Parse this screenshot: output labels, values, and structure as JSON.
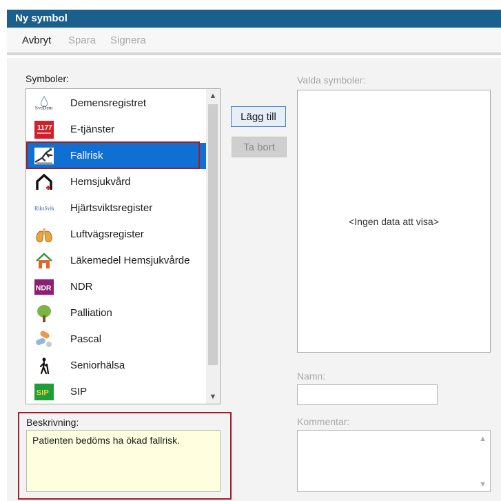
{
  "window": {
    "title": "Ny symbol"
  },
  "toolbar": {
    "cancel": "Avbryt",
    "save": "Spara",
    "sign": "Signera"
  },
  "symbols": {
    "label": "Symboler:",
    "items": [
      {
        "icon": "svedem-logo-icon",
        "label": "Demensregistret"
      },
      {
        "icon": "1177-logo-icon",
        "label": "E-tjänster"
      },
      {
        "icon": "fall-risk-icon",
        "label": "Fallrisk",
        "selected": true
      },
      {
        "icon": "home-care-icon",
        "label": "Hemsjukvård"
      },
      {
        "icon": "rikssvikt-logo-icon",
        "label": "Hjärtsviktsregister"
      },
      {
        "icon": "lungs-icon",
        "label": "Luftvägsregister"
      },
      {
        "icon": "home-medicine-icon",
        "label": "Läkemedel Hemsjukvårde"
      },
      {
        "icon": "ndr-logo-icon",
        "label": "NDR"
      },
      {
        "icon": "tree-icon",
        "label": "Palliation"
      },
      {
        "icon": "pills-icon",
        "label": "Pascal"
      },
      {
        "icon": "walking-person-icon",
        "label": "Seniorhälsa"
      },
      {
        "icon": "sip-logo-icon",
        "label": "SIP"
      }
    ],
    "logo_text": {
      "svedem": "SveDem",
      "e_services": "1177",
      "rikssvikt": "RiksSvikt",
      "ndr": "NDR",
      "sip": "SIP"
    }
  },
  "buttons": {
    "add": "Lägg till",
    "remove": "Ta bort"
  },
  "selected": {
    "label": "Valda symboler:",
    "empty_text": "<Ingen data att visa>"
  },
  "name": {
    "label": "Namn:",
    "value": ""
  },
  "comment": {
    "label": "Kommentar:",
    "value": ""
  },
  "description": {
    "label": "Beskrivning:",
    "value": "Patienten bedöms ha ökad fallrisk."
  },
  "colors": {
    "titlebar": "#1b5f8e",
    "selection": "#0f6fd3",
    "highlight_border": "#a41c24",
    "description_bg": "#ffffe0"
  }
}
